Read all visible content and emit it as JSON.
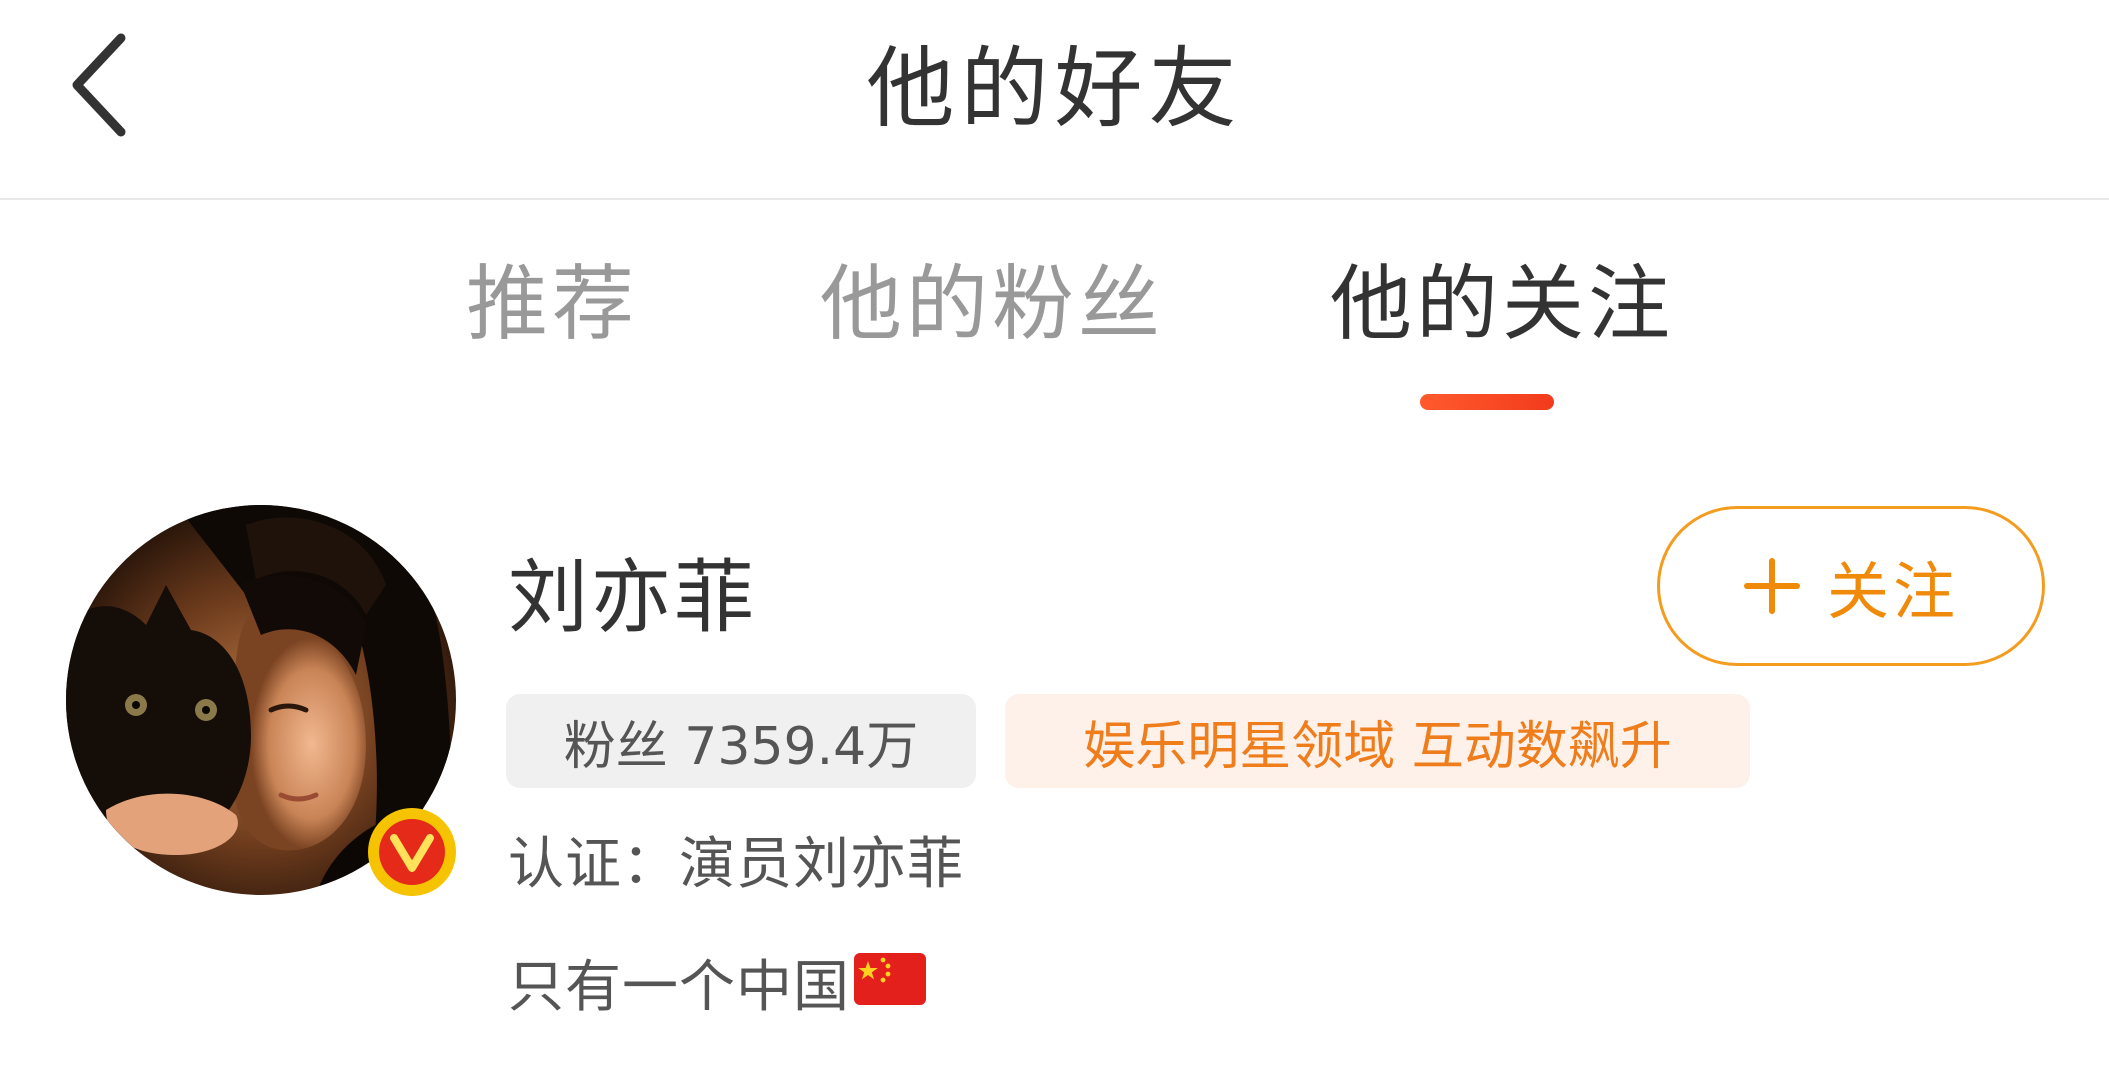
{
  "header": {
    "title": "他的好友"
  },
  "tabs": [
    {
      "label": "推荐",
      "active": false
    },
    {
      "label": "他的粉丝",
      "active": false
    },
    {
      "label": "他的关注",
      "active": true
    }
  ],
  "user": {
    "name": "刘亦菲",
    "follow_label": "关注",
    "fans_tag": "粉丝 7359.4万",
    "domain_tag": "娱乐明星领域 互动数飙升",
    "verification": "认证：演员刘亦菲",
    "bio": "只有一个中国",
    "bio_emoji": "china-flag",
    "verified_badge": "V"
  },
  "colors": {
    "accent_underline": "#f23b1c",
    "follow_orange": "#f08a0a",
    "domain_tag_bg": "#fdf1ea",
    "fans_tag_bg": "#f0f0f0",
    "badge_yellow": "#f5c300",
    "badge_red": "#e52a1a"
  },
  "icons": {
    "back": "chevron-left-icon",
    "follow": "plus-icon",
    "verified": "verified-v-icon"
  }
}
